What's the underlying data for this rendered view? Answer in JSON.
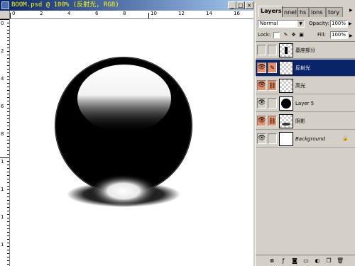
{
  "document": {
    "title": "BOOM.psd @ 100% (反射光, RGB)",
    "controls": {
      "minimize": "_",
      "maximize": "□",
      "close": "×"
    },
    "ruler_h_labels": [
      "0",
      "2",
      "4",
      "6",
      "8",
      "10",
      "12",
      "14",
      "16"
    ],
    "ruler_v_labels": [
      "0",
      "2",
      "4",
      "6",
      "8",
      "1",
      "1",
      "1",
      "1"
    ]
  },
  "layers_panel": {
    "tabs": [
      "Layers",
      "nnels",
      "hs",
      "ions",
      "tory"
    ],
    "blend_mode": "Normal",
    "opacity_label": "Opacity:",
    "opacity_value": "100%",
    "lock_label": "Lock:",
    "fill_label": "Fill:",
    "fill_value": "100%",
    "layers": [
      {
        "name": "基座部分",
        "visible": false,
        "selected": false,
        "linked": false
      },
      {
        "name": "反射光",
        "visible": true,
        "selected": true,
        "linked": false
      },
      {
        "name": "高光",
        "visible": true,
        "selected": false,
        "linked": true
      },
      {
        "name": "Layer 5",
        "visible": true,
        "selected": false,
        "linked": false
      },
      {
        "name": "阴影",
        "visible": true,
        "selected": false,
        "linked": true
      },
      {
        "name": "Background",
        "visible": true,
        "selected": false,
        "linked": false,
        "locked": true
      }
    ],
    "bottom_icons": [
      "link-icon",
      "effects-icon",
      "mask-icon",
      "new-set-icon",
      "adjustment-icon",
      "new-layer-icon",
      "trash-icon"
    ]
  },
  "colors": {
    "title_bar": "#0a246a",
    "title_text": "#ffff00",
    "selected_layer": "#0a246a",
    "visibility_on": "#e8906a"
  }
}
